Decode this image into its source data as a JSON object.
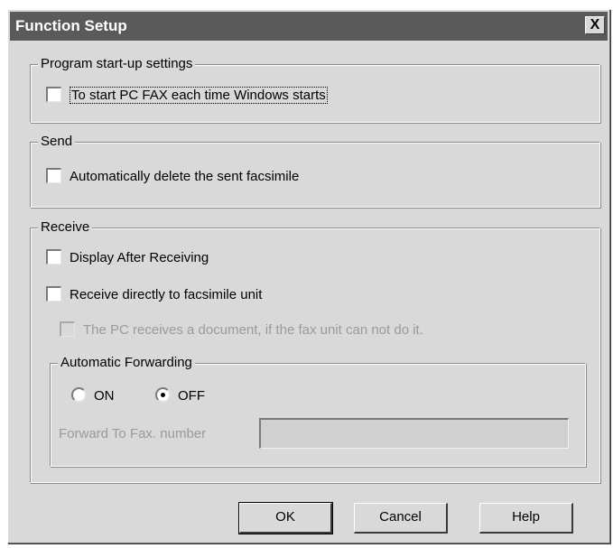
{
  "window": {
    "title": "Function Setup",
    "close_label": "X"
  },
  "startup": {
    "legend": "Program start-up settings",
    "start_with_windows": {
      "label": "To start PC FAX each time Windows starts",
      "checked": false
    }
  },
  "send": {
    "legend": "Send",
    "auto_delete": {
      "label": "Automatically delete the sent facsimile",
      "checked": false
    }
  },
  "receive": {
    "legend": "Receive",
    "display_after": {
      "label": "Display After Receiving",
      "checked": false
    },
    "receive_direct": {
      "label": "Receive directly to facsimile unit",
      "checked": false
    },
    "pc_receives": {
      "label": "The PC receives a document, if the fax unit can not do it.",
      "checked": false,
      "enabled": false
    },
    "forwarding": {
      "legend": "Automatic Forwarding",
      "on_label": "ON",
      "off_label": "OFF",
      "selected": "OFF",
      "forward_to_label": "Forward To Fax. number",
      "forward_to_value": ""
    }
  },
  "buttons": {
    "ok": "OK",
    "cancel": "Cancel",
    "help": "Help"
  }
}
